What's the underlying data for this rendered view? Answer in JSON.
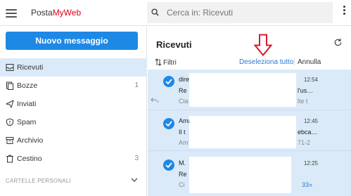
{
  "app": {
    "logo_part1": "Posta",
    "logo_part2": "MyWeb",
    "brand_red": "#e2001a",
    "accent_blue": "#1e88e5"
  },
  "search": {
    "placeholder": "Cerca in: Ricevuti"
  },
  "sidebar": {
    "new_message_label": "Nuovo messaggio",
    "folders": [
      {
        "label": "Ricevuti",
        "count": "",
        "icon": "inbox-icon",
        "active": true
      },
      {
        "label": "Bozze",
        "count": "1",
        "icon": "drafts-icon",
        "active": false
      },
      {
        "label": "Inviati",
        "count": "",
        "icon": "sent-icon",
        "active": false
      },
      {
        "label": "Spam",
        "count": "",
        "icon": "spam-icon",
        "active": false
      },
      {
        "label": "Archivio",
        "count": "",
        "icon": "archive-icon",
        "active": false
      },
      {
        "label": "Cestino",
        "count": "3",
        "icon": "trash-icon",
        "active": false
      }
    ],
    "personal_folders_title": "CARTELLE PERSONALI"
  },
  "main": {
    "title": "Ricevuti",
    "filters_label": "Filtri",
    "deselect_all_label": "Deseleziona tutto",
    "cancel_label": "Annulla",
    "messages": [
      {
        "sender": "dire",
        "subject": "Re",
        "preview": "Cia",
        "time": "12:54",
        "subject_tail": "l'us…",
        "preview_tail": "lte t",
        "more": "",
        "selected": true,
        "replied": true
      },
      {
        "sender": "Ama",
        "subject": "Il t",
        "preview": "Am",
        "time": "12:45",
        "subject_tail": "ebca…",
        "preview_tail": "71-2",
        "more": "",
        "selected": true,
        "replied": false
      },
      {
        "sender": "M.",
        "subject": "Re",
        "preview": "Ci",
        "time": "12:25",
        "subject_tail": "",
        "preview_tail": "",
        "more": "33»",
        "selected": true,
        "replied": false
      }
    ]
  }
}
